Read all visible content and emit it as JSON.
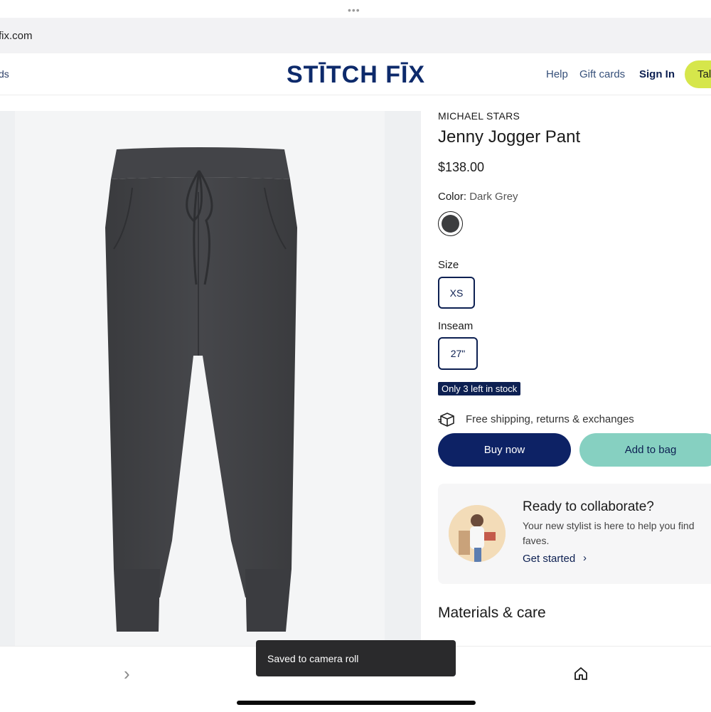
{
  "browser": {
    "url_fragment": "fix.com",
    "header_left_fragment": "ds"
  },
  "header": {
    "logo_text": "STĪTCH FĪX",
    "nav": {
      "help": "Help",
      "gift_cards": "Gift cards",
      "sign_in": "Sign In",
      "cta_fragment": "Tal"
    },
    "accent_color": "#d6e64b"
  },
  "product": {
    "brand": "MICHAEL STARS",
    "title": "Jenny Jogger Pant",
    "price": "$138.00",
    "color_label": "Color:",
    "color_value": "Dark Grey",
    "swatch_color": "#3c3d3f",
    "size_label": "Size",
    "size_selected": "XS",
    "inseam_label": "Inseam",
    "inseam_selected": "27\"",
    "stock_badge": "Only 3 left in stock",
    "shipping_text": "Free shipping, returns & exchanges",
    "buy_now": "Buy now",
    "add_to_bag": "Add to bag"
  },
  "collaborate": {
    "title": "Ready to collaborate?",
    "body": "Your new stylist is here to help you find faves.",
    "link": "Get started",
    "chevron": "›"
  },
  "materials_heading": "Materials & care",
  "bottom": {
    "next_glyph": "›",
    "toast": "Saved to camera roll"
  },
  "icons": {
    "shipping": "box-icon",
    "home": "home-icon",
    "next": "chevron-right-icon"
  }
}
